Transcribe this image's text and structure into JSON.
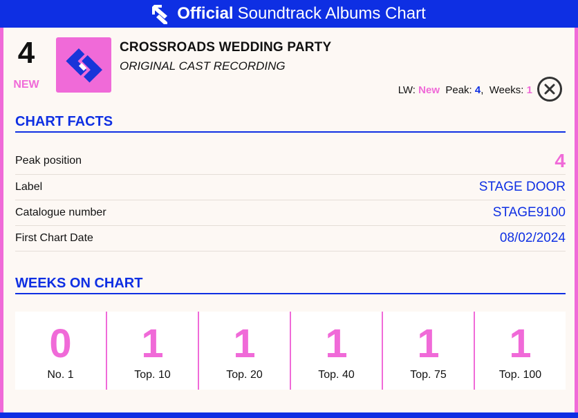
{
  "header": {
    "brand_strong": "Official",
    "brand_rest": "Soundtrack Albums Chart"
  },
  "entry": {
    "position": "4",
    "status": "NEW",
    "title": "CROSSROADS WEDDING PARTY",
    "subtitle": "ORIGINAL CAST RECORDING",
    "lw_label": "LW:",
    "lw_value": "New",
    "peak_label": "Peak:",
    "peak_value": "4",
    "weeks_label": "Weeks:",
    "weeks_value": "1"
  },
  "chart_facts": {
    "heading": "CHART FACTS",
    "rows": [
      {
        "label": "Peak position",
        "value": "4"
      },
      {
        "label": "Label",
        "value": "STAGE DOOR"
      },
      {
        "label": "Catalogue number",
        "value": "STAGE9100"
      },
      {
        "label": "First Chart Date",
        "value": "08/02/2024"
      }
    ]
  },
  "weeks_on_chart": {
    "heading": "WEEKS ON CHART",
    "cells": [
      {
        "value": "0",
        "label": "No. 1"
      },
      {
        "value": "1",
        "label": "Top. 10"
      },
      {
        "value": "1",
        "label": "Top. 20"
      },
      {
        "value": "1",
        "label": "Top. 40"
      },
      {
        "value": "1",
        "label": "Top. 75"
      },
      {
        "value": "1",
        "label": "Top. 100"
      }
    ]
  },
  "colors": {
    "brand_blue": "#0e2fe3",
    "accent_pink": "#f06ad8",
    "background": "#fdf8f4"
  },
  "icons": {
    "header_logo": "official-charts-logo-icon",
    "artwork": "official-charts-logo-icon",
    "close": "close-icon"
  }
}
